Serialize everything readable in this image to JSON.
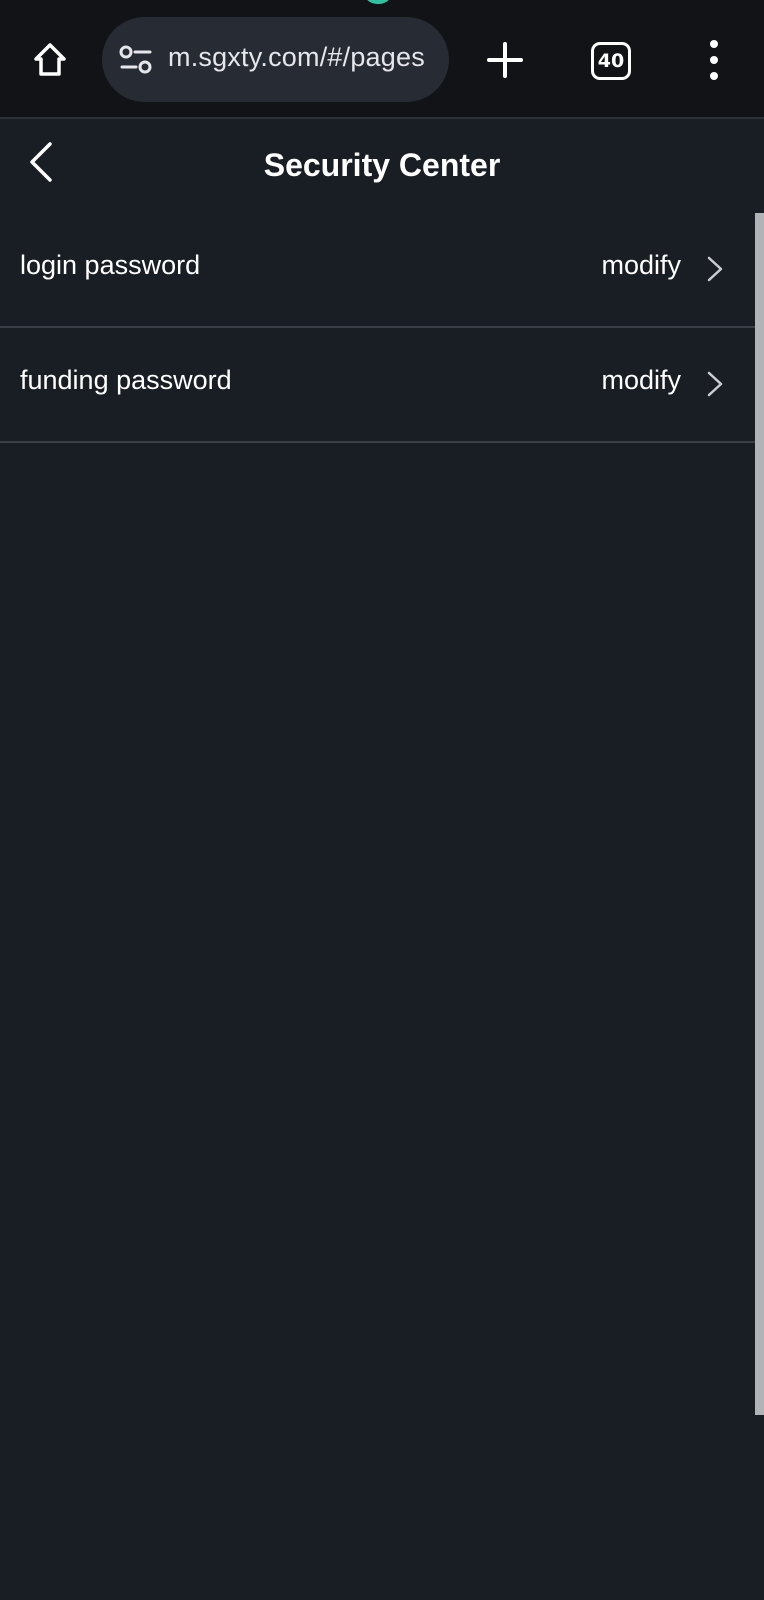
{
  "browser": {
    "url": "m.sgxty.com/#/pages",
    "tab_count": "40",
    "icons": {
      "home": "home-icon",
      "site_settings": "tune-icon",
      "new_tab": "plus-icon",
      "tabs": "tab-switcher-icon",
      "menu": "more-vert-icon"
    }
  },
  "header": {
    "title": "Security Center",
    "back_icon": "chevron-left-icon"
  },
  "settings": {
    "items": [
      {
        "label": "login password",
        "action": "modify",
        "icon": "chevron-right-icon"
      },
      {
        "label": "funding password",
        "action": "modify",
        "icon": "chevron-right-icon"
      }
    ]
  },
  "colors": {
    "background": "#191e25",
    "browser_bar": "#111317",
    "url_pill": "#272b34",
    "divider": "#3a3f47",
    "accent": "#2fc2a2"
  }
}
